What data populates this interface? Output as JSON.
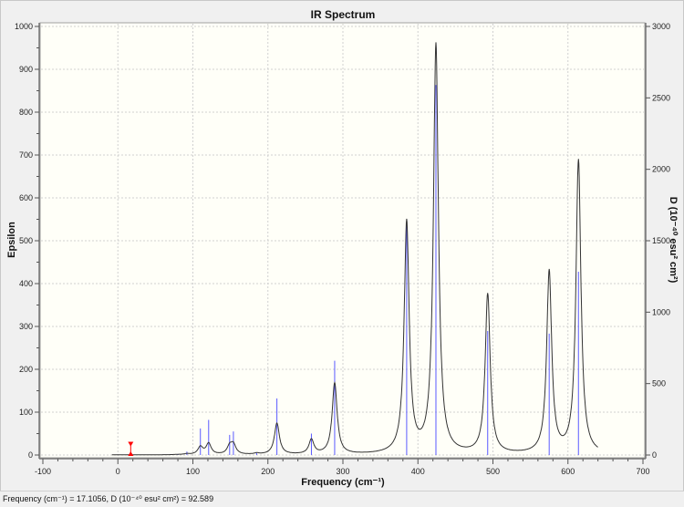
{
  "chart_data": {
    "type": "line",
    "title": "IR Spectrum",
    "xlabel": "Frequency (cm⁻¹)",
    "ylabel": "Epsilon",
    "y2label": "D (10⁻⁴⁰ esu² cm²)",
    "xlim": [
      -100,
      700
    ],
    "ylim": [
      0,
      1000
    ],
    "y2lim": [
      0,
      3000
    ],
    "xticks": [
      -100,
      0,
      100,
      200,
      300,
      400,
      500,
      600,
      700
    ],
    "yticks": [
      0,
      100,
      200,
      300,
      400,
      500,
      600,
      700,
      800,
      900,
      1000
    ],
    "y2ticks": [
      0,
      500,
      1000,
      1500,
      2000,
      2500,
      3000
    ],
    "grid": true,
    "spectrum_range": [
      -8,
      640
    ],
    "peak_halfwidth": 4,
    "epsilon_factor": 0.00087,
    "sticks": [
      {
        "freq": 80,
        "D": 6
      },
      {
        "freq": 92,
        "D": 24
      },
      {
        "freq": 110,
        "D": 186
      },
      {
        "freq": 121,
        "D": 246
      },
      {
        "freq": 149,
        "D": 141
      },
      {
        "freq": 154,
        "D": 165
      },
      {
        "freq": 185,
        "D": 15
      },
      {
        "freq": 212,
        "D": 396
      },
      {
        "freq": 258,
        "D": 150
      },
      {
        "freq": 289,
        "D": 660
      },
      {
        "freq": 385,
        "D": 1612
      },
      {
        "freq": 424,
        "D": 2590
      },
      {
        "freq": 493,
        "D": 868
      },
      {
        "freq": 575,
        "D": 850
      },
      {
        "freq": 614,
        "D": 1283
      }
    ],
    "selected": {
      "freq": 17.1056,
      "D": 92.589
    },
    "colors": {
      "spectrum": "#333333",
      "sticks": "#5a5aff",
      "selected": "#ff0000",
      "plot_bg": "#fffff8",
      "grid": "#d0d0d0"
    }
  },
  "status": {
    "text": "Frequency (cm⁻¹) = 17.1056, D (10⁻⁴⁰ esu² cm²) = 92.589"
  }
}
